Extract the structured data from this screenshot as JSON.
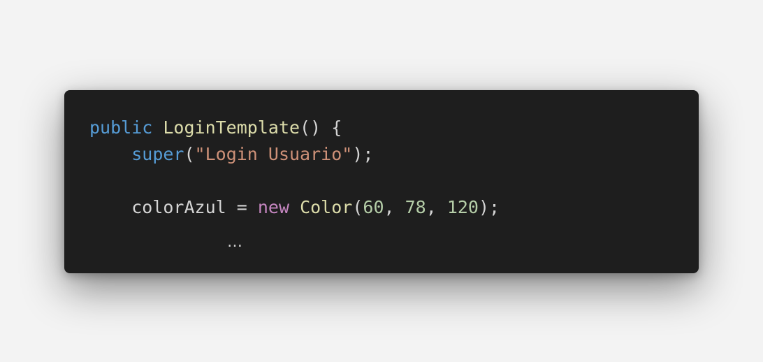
{
  "code": {
    "line1": {
      "keyword": "public",
      "space": " ",
      "name": "LoginTemplate",
      "rest": "() {"
    },
    "line2": {
      "indent": "    ",
      "keyword": "super",
      "open": "(",
      "string": "\"Login Usuario\"",
      "close": ");"
    },
    "line4": {
      "indent": "    ",
      "variable": "colorAzul",
      "assign": " = ",
      "keyword": "new",
      "space": " ",
      "type": "Color",
      "open": "(",
      "n1": "60",
      "sep1": ", ",
      "n2": "78",
      "sep2": ", ",
      "n3": "120",
      "close": ");"
    },
    "ellipsis": "…"
  }
}
